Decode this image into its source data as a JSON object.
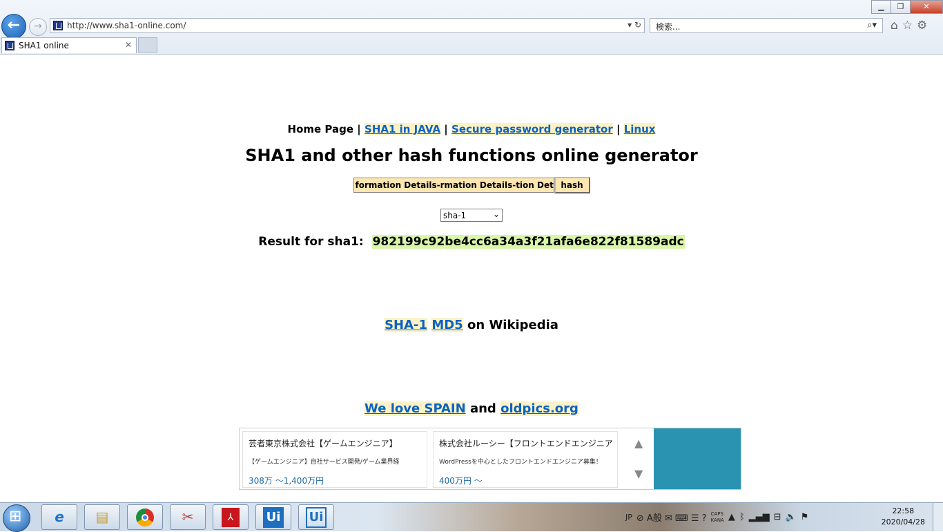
{
  "browser": {
    "url": "http://www.sha1-online.com/",
    "search_placeholder": "検索...",
    "tab_title": "SHA1 online",
    "icons": [
      "back-arrow-icon",
      "forward-arrow-icon",
      "refresh-icon",
      "search-icon",
      "home-icon",
      "star-icon",
      "gear-icon"
    ]
  },
  "window": {
    "minimize": "▁",
    "restore": "❐",
    "close": "✕"
  },
  "page": {
    "nav": {
      "home": "Home Page",
      "sep": "|",
      "java": "SHA1 in JAVA",
      "password": "Secure password generator",
      "linux": "Linux"
    },
    "title": "SHA1 and other hash functions online generator",
    "input_value": "formation Details-rmation Details-tion Details",
    "hash_button": "hash",
    "algorithm_selected": "sha-1",
    "result_label": "Result for sha1:",
    "result_hash": "982199c92be4cc6a34a3f21afa6e822f81589adc",
    "wiki": {
      "sha1": "SHA-1",
      "md5": "MD5",
      "suffix": "on Wikipedia"
    },
    "spain": {
      "spain": "We love SPAIN",
      "and": "and",
      "oldpics": "oldpics.org"
    }
  },
  "ad": {
    "cards": [
      {
        "title": "芸者東京株式会社【ゲームエンジニア】",
        "desc": "【ゲームエンジニア】自社サービス開発/ゲーム業界経",
        "price": "308万 〜1,400万円"
      },
      {
        "title": "株式会社ルーシー【フロントエンドエンジニア",
        "desc": "WordPressを中心としたフロントエンドエンジニア募集！",
        "price": "400万円 〜"
      }
    ],
    "up": "▲",
    "down": "▼"
  },
  "taskbar": {
    "lang": "JP",
    "caps": "CAPS",
    "kana": "KANA",
    "time": "22:58",
    "date": "2020/04/28",
    "ui1": "Ui",
    "ui2": "Ui",
    "pdf": "⅄"
  }
}
